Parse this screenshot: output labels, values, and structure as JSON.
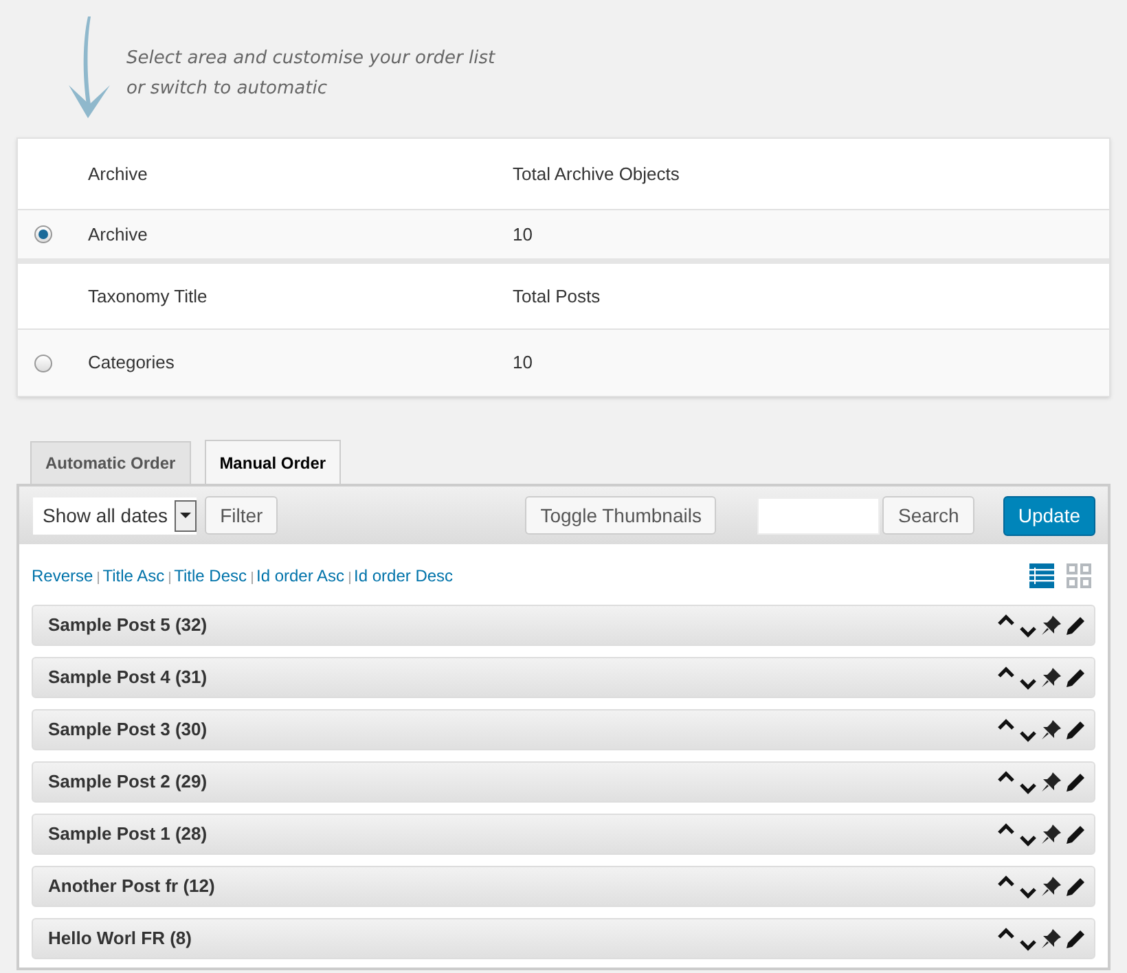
{
  "hint": {
    "lines": [
      "Select area and customise your order list",
      "or switch to automatic"
    ]
  },
  "areas": [
    {
      "columns": [
        "Archive",
        "Total Archive Objects"
      ],
      "row": {
        "name": "Archive",
        "count": "10",
        "selected": true
      }
    },
    {
      "columns": [
        "Taxonomy Title",
        "Total Posts"
      ],
      "row": {
        "name": "Categories",
        "count": "10",
        "selected": false
      }
    }
  ],
  "tabs": [
    {
      "label": "Automatic Order",
      "selected": false
    },
    {
      "label": "Manual Order",
      "selected": true
    }
  ],
  "toolbar": {
    "date_filter": "Show all dates",
    "filter_button": "Filter",
    "toggle_button": "Toggle Thumbnails",
    "search_button": "Search",
    "update_button": "Update"
  },
  "sort_links": [
    "Reverse",
    "Title Asc",
    "Title Desc",
    "Id order Asc",
    "Id order Desc"
  ],
  "view_modes": [
    {
      "kind": "list",
      "selected": true
    },
    {
      "kind": "grid",
      "selected": false
    }
  ],
  "posts": [
    {
      "title": "Sample Post 5 (32)"
    },
    {
      "title": "Sample Post 4 (31)"
    },
    {
      "title": "Sample Post 3 (30)"
    },
    {
      "title": "Sample Post 2 (29)"
    },
    {
      "title": "Sample Post 1 (28)"
    },
    {
      "title": "Another Post fr (12)"
    },
    {
      "title": "Hello Worl FR (8)"
    }
  ]
}
